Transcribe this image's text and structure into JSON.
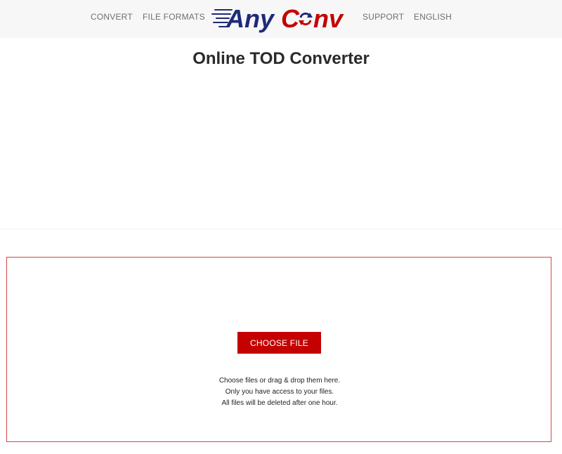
{
  "nav": {
    "convert": "CONVERT",
    "file_formats": "FILE FORMATS",
    "support": "SUPPORT",
    "language": "ENGLISH"
  },
  "logo": {
    "text_any": "Any",
    "text_c": "C",
    "text_nv": "nv",
    "icon": "refresh-arrows-icon",
    "navy": "#1e2a78",
    "red": "#c40000"
  },
  "page": {
    "title": "Online TOD Converter"
  },
  "upload": {
    "button_label": "CHOOSE FILE",
    "hint_line1": "Choose files or drag & drop them here.",
    "hint_line2": "Only you have access to your files.",
    "hint_line3": "All files will be deleted after one hour.",
    "accent": "#c40000"
  }
}
